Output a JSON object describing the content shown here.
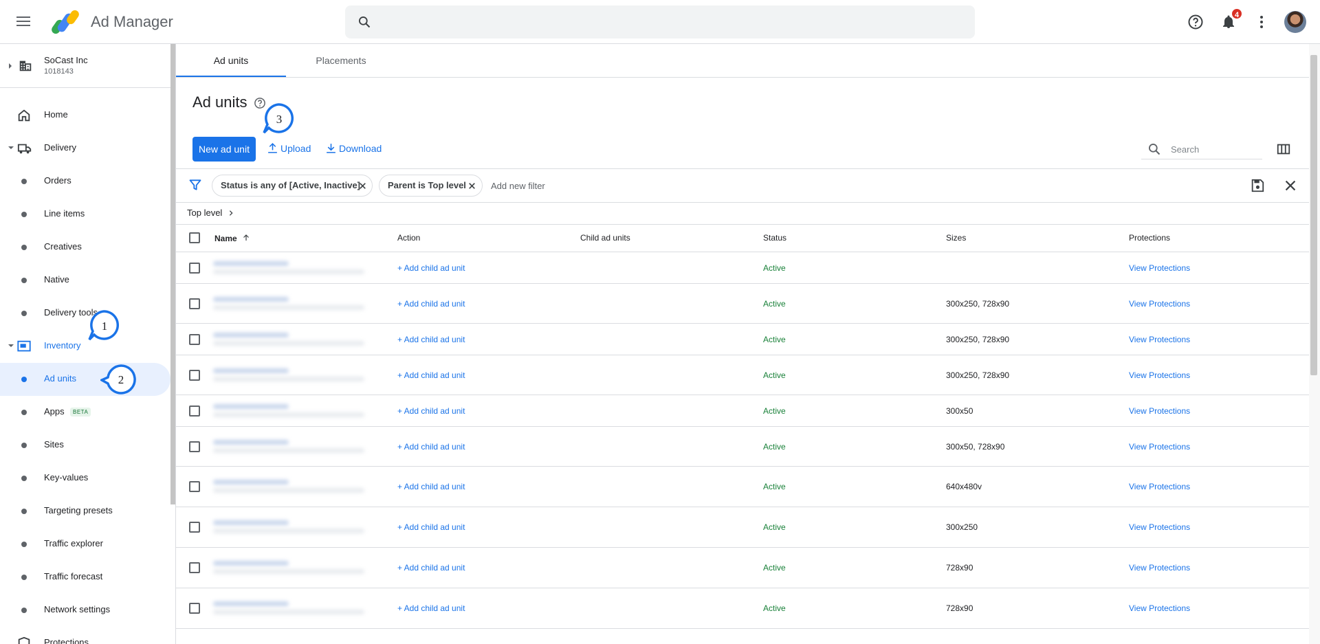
{
  "header": {
    "app_title": "Ad Manager",
    "notification_count": "4",
    "icons": [
      "menu-icon",
      "search-icon",
      "help-icon",
      "notifications-icon",
      "more-vert-icon",
      "avatar"
    ]
  },
  "network": {
    "name": "SoCast Inc",
    "id": "1018143"
  },
  "nav": {
    "home": "Home",
    "delivery": "Delivery",
    "orders": "Orders",
    "line_items": "Line items",
    "creatives": "Creatives",
    "native": "Native",
    "delivery_tools": "Delivery tools",
    "inventory": "Inventory",
    "ad_units": "Ad units",
    "apps": "Apps",
    "apps_badge": "BETA",
    "sites": "Sites",
    "key_values": "Key-values",
    "targeting_presets": "Targeting presets",
    "traffic_explorer": "Traffic explorer",
    "traffic_forecast": "Traffic forecast",
    "network_settings": "Network settings",
    "protections": "Protections"
  },
  "tabs": {
    "ad_units": "Ad units",
    "placements": "Placements"
  },
  "page": {
    "title": "Ad units",
    "new_button": "New ad unit",
    "upload": "Upload",
    "download": "Download",
    "search_placeholder": "Search"
  },
  "filters": {
    "chip1": "Status is any of [Active, Inactive]",
    "chip2": "Parent is Top level",
    "add": "Add new filter"
  },
  "breadcrumb": "Top level",
  "table": {
    "columns": {
      "name": "Name",
      "action": "Action",
      "child": "Child ad units",
      "status": "Status",
      "sizes": "Sizes",
      "protections": "Protections"
    },
    "rows": [
      {
        "action": "+ Add child ad unit",
        "status": "Active",
        "sizes": "",
        "protections": "View Protections"
      },
      {
        "action": "+ Add child ad unit",
        "status": "Active",
        "sizes": "300x250, 728x90",
        "protections": "View Protections"
      },
      {
        "action": "+ Add child ad unit",
        "status": "Active",
        "sizes": "300x250, 728x90",
        "protections": "View Protections"
      },
      {
        "action": "+ Add child ad unit",
        "status": "Active",
        "sizes": "300x250, 728x90",
        "protections": "View Protections"
      },
      {
        "action": "+ Add child ad unit",
        "status": "Active",
        "sizes": "300x50",
        "protections": "View Protections"
      },
      {
        "action": "+ Add child ad unit",
        "status": "Active",
        "sizes": "300x50, 728x90",
        "protections": "View Protections"
      },
      {
        "action": "+ Add child ad unit",
        "status": "Active",
        "sizes": "640x480v",
        "protections": "View Protections"
      },
      {
        "action": "+ Add child ad unit",
        "status": "Active",
        "sizes": "300x250",
        "protections": "View Protections"
      },
      {
        "action": "+ Add child ad unit",
        "status": "Active",
        "sizes": "728x90",
        "protections": "View Protections"
      },
      {
        "action": "+ Add child ad unit",
        "status": "Active",
        "sizes": "728x90",
        "protections": "View Protections"
      }
    ]
  },
  "callouts": {
    "one": "1",
    "two": "2",
    "three": "3"
  },
  "colors": {
    "accent": "#1a73e8",
    "active": "#188038",
    "badge": "#d93025"
  }
}
